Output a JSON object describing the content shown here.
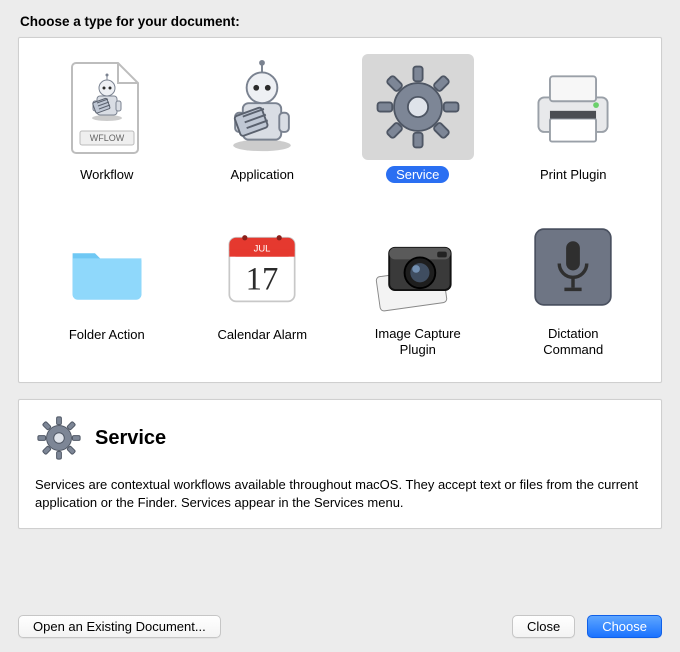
{
  "heading": "Choose a type for your document:",
  "types": [
    {
      "id": "workflow",
      "label": "Workflow",
      "icon": "workflow-icon",
      "selected": false
    },
    {
      "id": "application",
      "label": "Application",
      "icon": "application-icon",
      "selected": false
    },
    {
      "id": "service",
      "label": "Service",
      "icon": "service-icon",
      "selected": true
    },
    {
      "id": "print-plugin",
      "label": "Print Plugin",
      "icon": "printer-icon",
      "selected": false
    },
    {
      "id": "folder-action",
      "label": "Folder Action",
      "icon": "folder-icon",
      "selected": false
    },
    {
      "id": "calendar-alarm",
      "label": "Calendar Alarm",
      "icon": "calendar-icon",
      "selected": false
    },
    {
      "id": "image-capture-plugin",
      "label": "Image Capture\nPlugin",
      "icon": "camera-icon",
      "selected": false
    },
    {
      "id": "dictation-command",
      "label": "Dictation\nCommand",
      "icon": "microphone-icon",
      "selected": false
    }
  ],
  "info": {
    "title": "Service",
    "body": "Services are contextual workflows available throughout macOS. They accept text or files from the current application or the Finder. Services appear in the Services menu."
  },
  "buttons": {
    "open": "Open an Existing Document...",
    "close": "Close",
    "choose": "Choose"
  },
  "workflow_badge": "WFLOW",
  "calendar": {
    "month": "JUL",
    "day": "17"
  }
}
